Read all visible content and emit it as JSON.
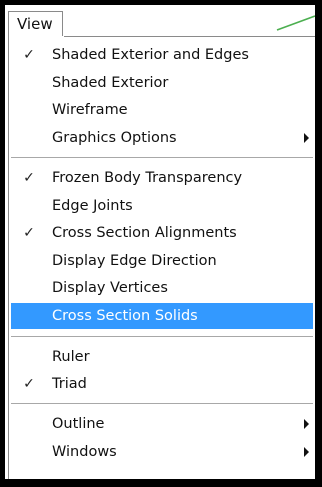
{
  "menubar": {
    "title": "View"
  },
  "menu": {
    "items": [
      {
        "label": "Shaded Exterior and Edges",
        "checked": true
      },
      {
        "label": "Shaded Exterior",
        "checked": false
      },
      {
        "label": "Wireframe",
        "checked": false
      },
      {
        "label": "Graphics Options",
        "checked": false,
        "submenu": true
      },
      {
        "label": "Frozen Body Transparency",
        "checked": true
      },
      {
        "label": "Edge Joints",
        "checked": false
      },
      {
        "label": "Cross Section Alignments",
        "checked": true
      },
      {
        "label": "Display Edge Direction",
        "checked": false
      },
      {
        "label": "Display Vertices",
        "checked": false
      },
      {
        "label": "Cross Section Solids",
        "checked": false,
        "highlighted": true
      },
      {
        "label": "Ruler",
        "checked": false
      },
      {
        "label": "Triad",
        "checked": true
      },
      {
        "label": "Outline",
        "checked": false,
        "submenu": true
      },
      {
        "label": "Windows",
        "checked": false,
        "submenu": true
      }
    ],
    "check_glyph": "✓"
  },
  "colors": {
    "highlight": "#3399ff",
    "frame": "#000000",
    "accent": "#4caf50"
  }
}
